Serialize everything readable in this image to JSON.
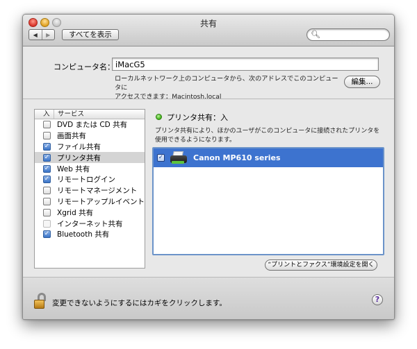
{
  "window": {
    "title": "共有"
  },
  "toolbar": {
    "back_label": "◀",
    "forward_label": "▶",
    "show_all_label": "すべてを表示",
    "search_placeholder": ""
  },
  "computer_name": {
    "label": "コンピュータ名：",
    "value": "iMacG5",
    "note_line1": "ローカルネットワーク上のコンピュータから、次のアドレスでこのコンピュータに",
    "note_line2": "アクセスできます：Macintosh.local",
    "edit_label": "編集..."
  },
  "services": {
    "header_on": "入",
    "header_service": "サービス",
    "items": [
      {
        "label": "DVD または CD 共有",
        "checked": false,
        "selected": false,
        "enabled": true
      },
      {
        "label": "画面共有",
        "checked": false,
        "selected": false,
        "enabled": true
      },
      {
        "label": "ファイル共有",
        "checked": true,
        "selected": false,
        "enabled": true
      },
      {
        "label": "プリンタ共有",
        "checked": true,
        "selected": true,
        "enabled": true
      },
      {
        "label": "Web 共有",
        "checked": true,
        "selected": false,
        "enabled": true
      },
      {
        "label": "リモートログイン",
        "checked": true,
        "selected": false,
        "enabled": true
      },
      {
        "label": "リモートマネージメント",
        "checked": false,
        "selected": false,
        "enabled": true
      },
      {
        "label": "リモートアップルイベント",
        "checked": false,
        "selected": false,
        "enabled": true
      },
      {
        "label": "Xgrid 共有",
        "checked": false,
        "selected": false,
        "enabled": true
      },
      {
        "label": "インターネット共有",
        "checked": false,
        "selected": false,
        "enabled": false
      },
      {
        "label": "Bluetooth 共有",
        "checked": true,
        "selected": false,
        "enabled": true
      }
    ]
  },
  "detail": {
    "status": "プリンタ共有：入",
    "status_color": "#3cae14",
    "description_line1": "プリンタ共有により、ほかのユーザがこのコンピュータに接続されたプリンタを",
    "description_line2": "使用できるようになります。",
    "printers": [
      {
        "name": "Canon MP610 series",
        "checked": true
      }
    ],
    "prefs_button_label": "“プリントとファクス”環境設定を開く"
  },
  "footer": {
    "lock_text": "変更できないようにするにはカギをクリックします。",
    "help_label": "?"
  },
  "colors": {
    "selection": "#3d73cf",
    "checkbox_on": "#3a74c8"
  }
}
